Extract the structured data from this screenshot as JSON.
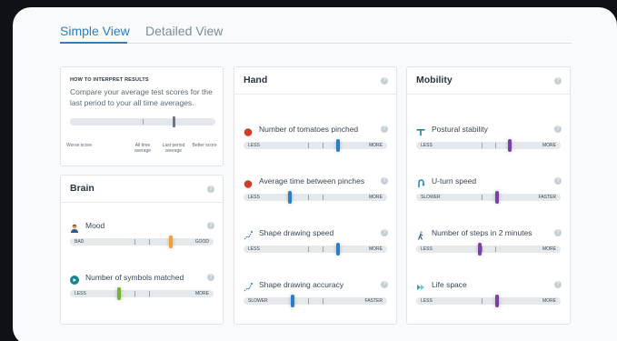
{
  "tabs": [
    {
      "label": "Simple View",
      "active": true
    },
    {
      "label": "Detailed View",
      "active": false
    }
  ],
  "interpret": {
    "heading": "HOW TO INTERPRET RESULTS",
    "text": "Compare your average test scores for the last period to your all time averages.",
    "worse": "Worse score",
    "all_time": "All time average",
    "last_period": "Last period average",
    "better": "Better score"
  },
  "brain": {
    "title": "Brain",
    "metrics": [
      {
        "label": "Mood",
        "icon": "person-icon",
        "lo": "BAD",
        "hi": "GOOD",
        "level": 0.7,
        "color": "#f0a030"
      },
      {
        "label": "Number of symbols matched",
        "icon": "symbol-match-icon",
        "lo": "LESS",
        "hi": "MORE",
        "level": 0.34,
        "color": "#6cb82e"
      }
    ]
  },
  "hand": {
    "title": "Hand",
    "metrics": [
      {
        "label": "Number of tomatoes pinched",
        "icon": "tomato-icon",
        "lo": "LESS",
        "hi": "MORE",
        "level": 0.66,
        "color": "#2a7dc8"
      },
      {
        "label": "Average time between pinches",
        "icon": "tomato-icon",
        "lo": "LESS",
        "hi": "MORE",
        "level": 0.32,
        "color": "#2a7dc8"
      },
      {
        "label": "Shape drawing speed",
        "icon": "shape-draw-icon",
        "lo": "LESS",
        "hi": "MORE",
        "level": 0.66,
        "color": "#2a7dc8"
      },
      {
        "label": "Shape drawing accuracy",
        "icon": "shape-draw-icon",
        "lo": "SLOWER",
        "hi": "FASTER",
        "level": 0.34,
        "color": "#2a7dc8"
      }
    ]
  },
  "mobility": {
    "title": "Mobility",
    "metrics": [
      {
        "label": "Postural stability",
        "icon": "balance-icon",
        "lo": "LESS",
        "hi": "MORE",
        "level": 0.65,
        "color": "#7a3fa8"
      },
      {
        "label": "U-turn speed",
        "icon": "u-turn-icon",
        "lo": "SLOWER",
        "hi": "FASTER",
        "level": 0.56,
        "color": "#7a3fa8"
      },
      {
        "label": "Number of steps in 2 minutes",
        "icon": "walking-icon",
        "lo": "LESS",
        "hi": "MORE",
        "level": 0.44,
        "color": "#7a3fa8"
      },
      {
        "label": "Life space",
        "icon": "life-space-icon",
        "lo": "LESS",
        "hi": "MORE",
        "level": 0.56,
        "color": "#7a3fa8"
      }
    ]
  },
  "colors": {
    "accent": "#2e7fc2",
    "brain_mood": "#f0a030",
    "brain_symbols": "#6cb82e",
    "hand": "#2a7dc8",
    "mobility": "#7a3fa8"
  }
}
